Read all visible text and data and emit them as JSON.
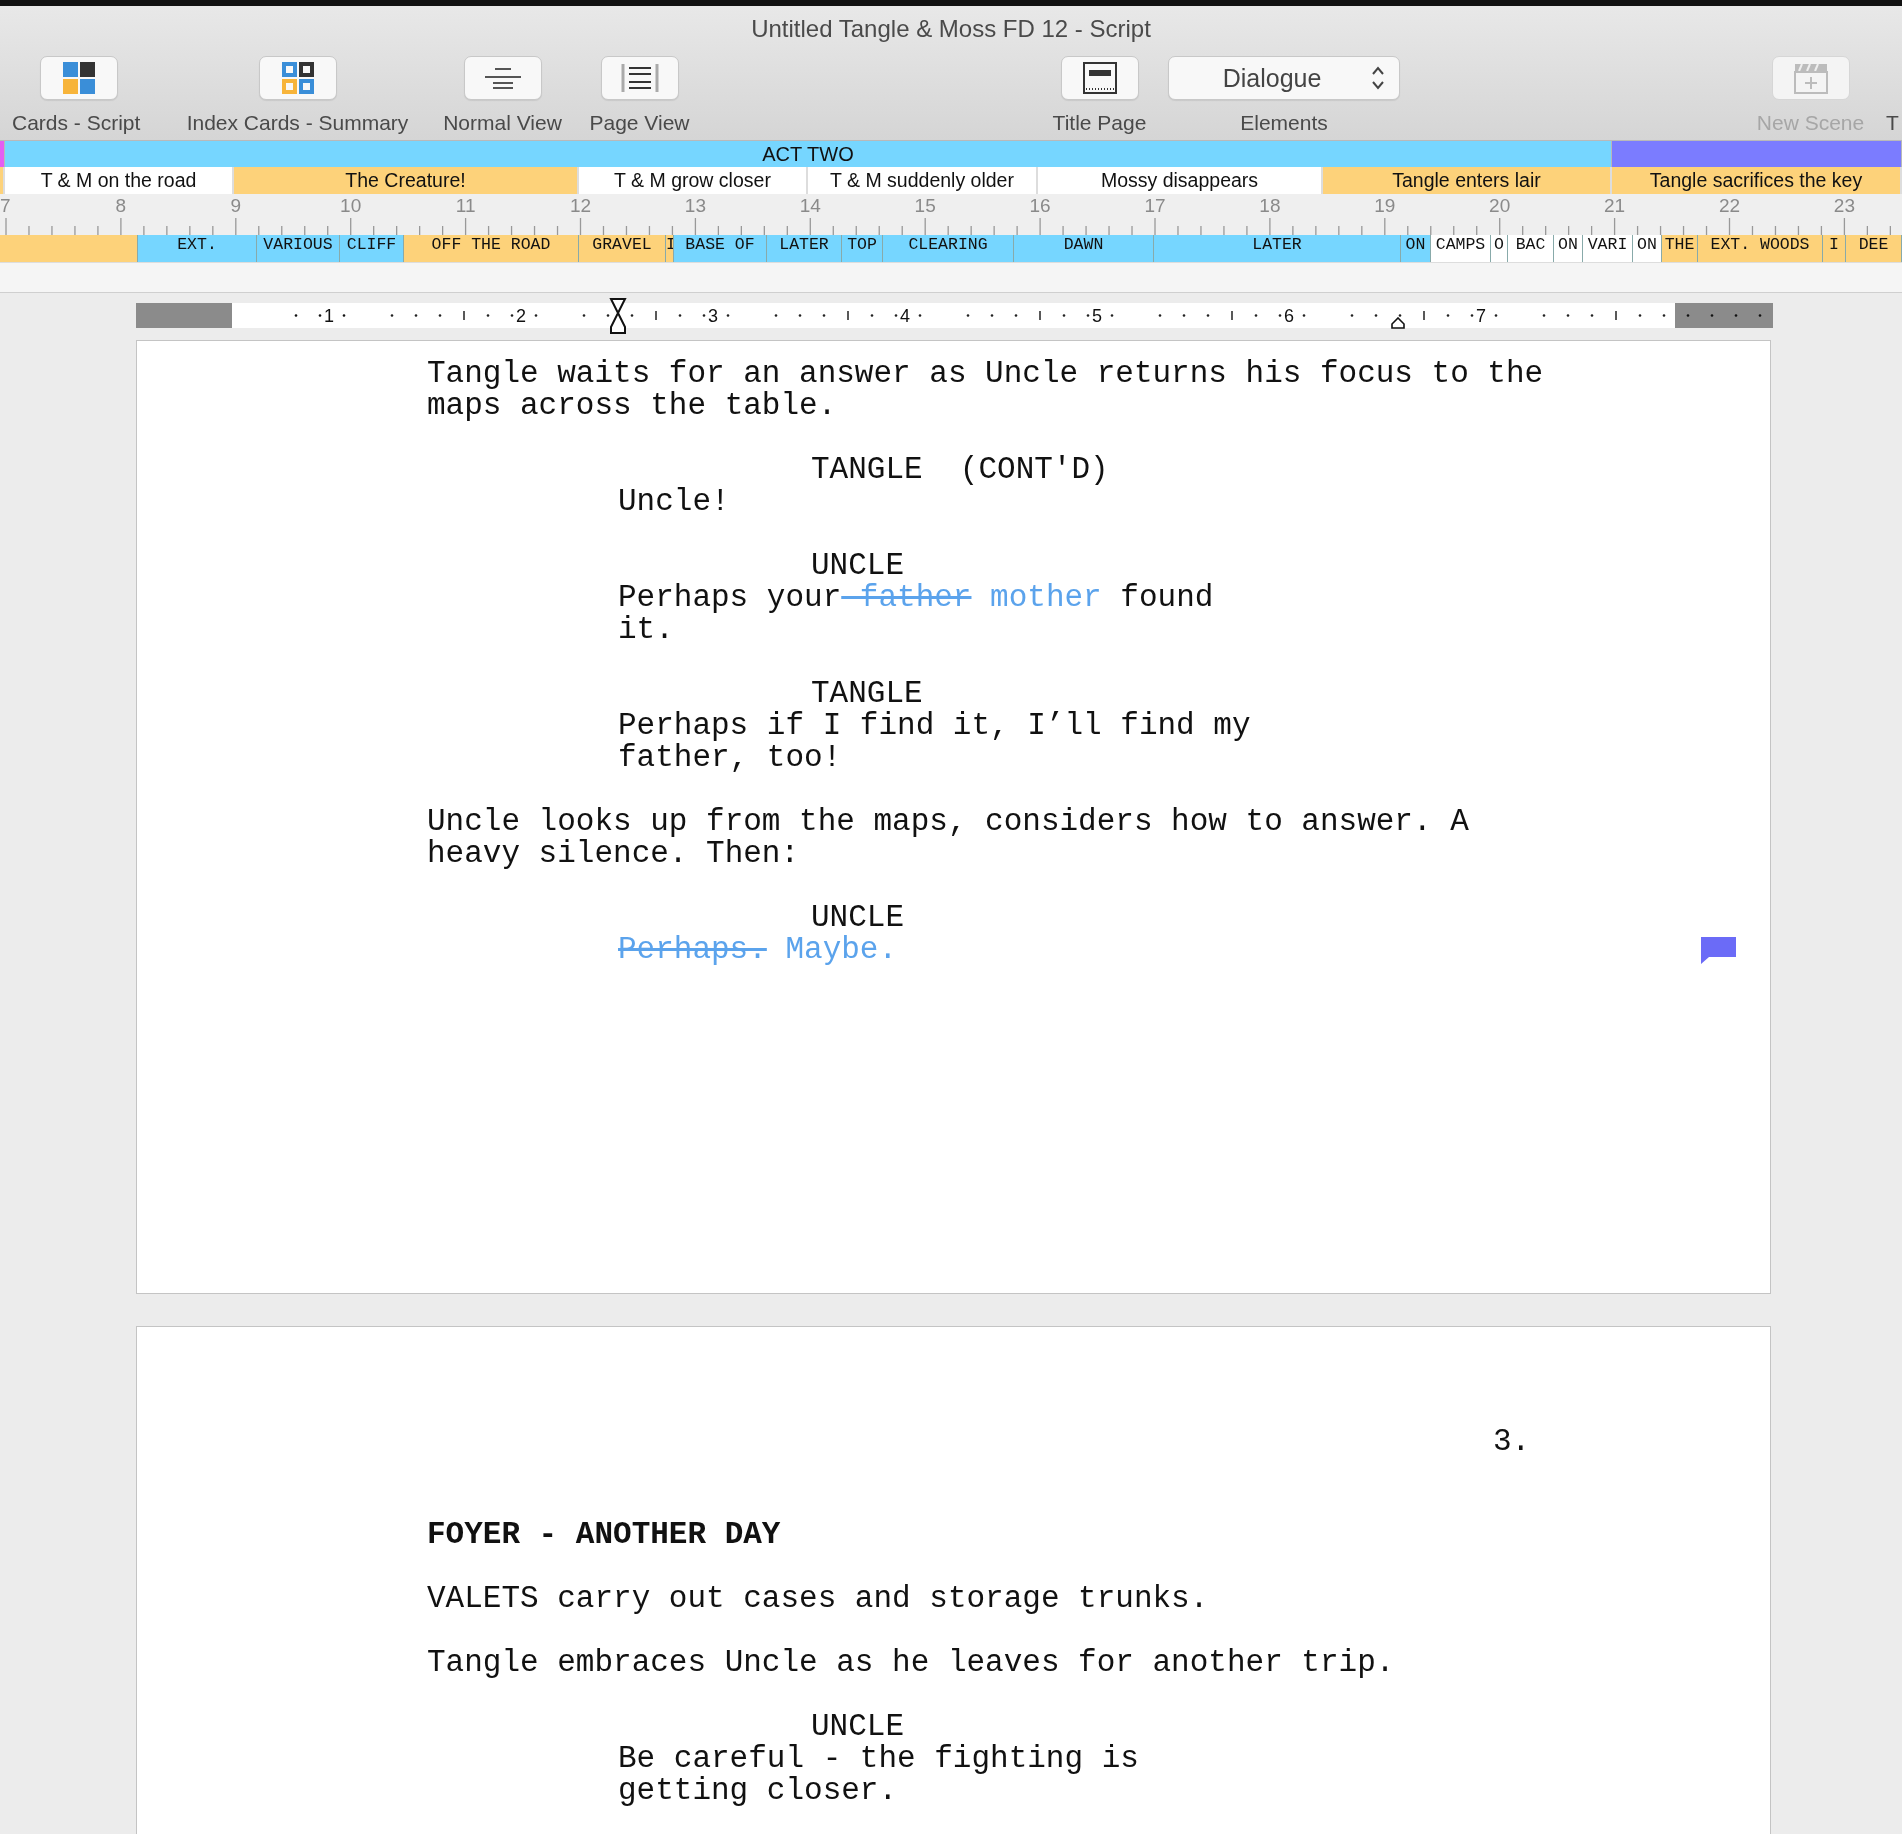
{
  "window": {
    "title": "Untitled Tangle & Moss FD 12 - Script"
  },
  "toolbar": {
    "items": [
      {
        "kind": "button",
        "label": "Cards - Script",
        "disabled": false
      },
      {
        "kind": "button",
        "label": "Index Cards - Summary",
        "disabled": false
      },
      {
        "kind": "button",
        "label": "Normal View",
        "disabled": false
      },
      {
        "kind": "button",
        "label": "Page View",
        "disabled": false
      },
      {
        "kind": "button",
        "label": "Title Page",
        "disabled": false
      },
      {
        "kind": "popup",
        "value": "Dialogue",
        "label": "Elements",
        "disabled": false
      },
      {
        "kind": "button",
        "label": "New Scene",
        "disabled": true
      },
      {
        "kind": "text",
        "label": "T",
        "disabled": false
      }
    ]
  },
  "timeline": {
    "acts": [
      {
        "color": "#e35ef2"
      },
      {
        "title": "ACT TWO",
        "color": "#76d6ff"
      },
      {
        "color": "#7b7cff"
      }
    ],
    "sequences": [
      {
        "color": "#fdd27a"
      },
      {
        "title": "T & M on the road",
        "color": "#ffffff"
      },
      {
        "title": "The Creature!",
        "color": "#fdd27a"
      },
      {
        "title": "T & M grow closer",
        "color": "#ffffff"
      },
      {
        "title": "T & M suddenly older",
        "color": "#ffffff"
      },
      {
        "title": "Mossy disappears",
        "color": "#ffffff"
      },
      {
        "title": "Tangle enters lair",
        "color": "#fdd27a"
      },
      {
        "title": "Tangle sacrifices the key",
        "color": "#fdd27a"
      }
    ],
    "ruler": [
      "7",
      "8",
      "9",
      "10",
      "11",
      "12",
      "13",
      "14",
      "15",
      "16",
      "17",
      "18",
      "19",
      "20",
      "21",
      "22",
      "23"
    ],
    "scenes": [
      {
        "color": "#fdd27a"
      },
      {
        "title": "EXT.",
        "color": "#76d6ff"
      },
      {
        "title": "VARIOUS",
        "color": "#76d6ff"
      },
      {
        "title": "CLIFF",
        "color": "#76d6ff"
      },
      {
        "title": "OFF THE ROAD",
        "color": "#fdd27a"
      },
      {
        "title": "GRAVEL",
        "color": "#fdd27a"
      },
      {
        "title": "I",
        "color": "#fdd27a"
      },
      {
        "title": "BASE OF",
        "color": "#76d6ff"
      },
      {
        "title": "LATER",
        "color": "#76d6ff"
      },
      {
        "title": "TOP",
        "color": "#76d6ff"
      },
      {
        "title": "CLEARING",
        "color": "#76d6ff"
      },
      {
        "title": "DAWN",
        "color": "#76d6ff"
      },
      {
        "title": "LATER",
        "color": "#76d6ff"
      },
      {
        "title": "ON",
        "color": "#76d6ff"
      },
      {
        "title": "CAMPS",
        "color": "#ffffff"
      },
      {
        "title": "O",
        "color": "#ffffff"
      },
      {
        "title": "BAC",
        "color": "#ffffff"
      },
      {
        "title": "ON",
        "color": "#ffffff"
      },
      {
        "title": "VARI",
        "color": "#ffffff"
      },
      {
        "title": "ON",
        "color": "#ffffff"
      },
      {
        "title": "THE",
        "color": "#fdd27a"
      },
      {
        "title": "EXT. WOODS",
        "color": "#fdd27a"
      },
      {
        "title": "I",
        "color": "#fdd27a"
      },
      {
        "title": "DEE",
        "color": "#fdd27a"
      }
    ]
  },
  "page_ruler": [
    "1",
    "2",
    "3",
    "4",
    "5",
    "6",
    "7"
  ],
  "pages": [
    {
      "elements": [
        {
          "kind": "action",
          "text": "Tangle waits for an answer as Uncle returns his focus to the maps across the table."
        },
        {
          "kind": "character",
          "text": "TANGLE  (CONT'D)"
        },
        {
          "kind": "dialogue",
          "text": "Uncle!"
        },
        {
          "kind": "character",
          "text": "UNCLE"
        },
        {
          "kind": "dialogue",
          "segments": [
            {
              "text": "Perhaps your",
              "deleted": false,
              "inserted": false
            },
            {
              "text": " father",
              "deleted": true,
              "inserted": false
            },
            {
              "text": " mother",
              "deleted": false,
              "inserted": true
            },
            {
              "text": " found it.",
              "deleted": false,
              "inserted": false
            }
          ]
        },
        {
          "kind": "character",
          "text": "TANGLE"
        },
        {
          "kind": "dialogue",
          "text": "Perhaps if I find it, I’ll find my father, too!"
        },
        {
          "kind": "action",
          "text": "Uncle looks up from the maps, considers how to answer. A heavy silence. Then:"
        },
        {
          "kind": "character",
          "text": "UNCLE"
        },
        {
          "kind": "dialogue",
          "note": true,
          "segments": [
            {
              "text": "Perhaps.",
              "deleted": true,
              "inserted": false
            },
            {
              "text": " Maybe.",
              "deleted": false,
              "inserted": true
            }
          ]
        }
      ]
    },
    {
      "number": "3.",
      "elements": [
        {
          "kind": "heading",
          "text": "FOYER - ANOTHER DAY"
        },
        {
          "kind": "action",
          "text": "VALETS carry out cases and storage trunks."
        },
        {
          "kind": "action",
          "text": "Tangle embraces Uncle as he leaves for another trip."
        },
        {
          "kind": "character",
          "text": "UNCLE"
        },
        {
          "kind": "dialogue",
          "text": "Be careful - the fighting is getting closer."
        }
      ]
    }
  ]
}
